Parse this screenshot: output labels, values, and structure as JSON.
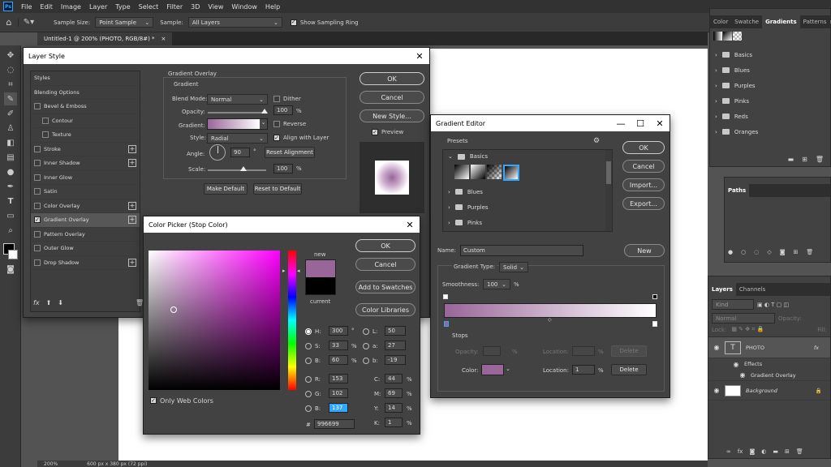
{
  "menubar": {
    "logo": "Ps",
    "items": [
      "File",
      "Edit",
      "Image",
      "Layer",
      "Type",
      "Select",
      "Filter",
      "3D",
      "View",
      "Window",
      "Help"
    ]
  },
  "options": {
    "sample_size_label": "Sample Size:",
    "sample_size_value": "Point Sample",
    "sample_label": "Sample:",
    "sample_value": "All Layers",
    "show_ring_label": "Show Sampling Ring"
  },
  "document": {
    "tab_title": "Untitled-1 @ 200% (PHOTO, RGB/8#) *",
    "close": "×"
  },
  "status": {
    "zoom": "200%",
    "size": "600 px x 380 px (72 ppi)"
  },
  "gradients_panel": {
    "tabs": [
      "Color",
      "Swatche",
      "Gradients",
      "Patterns"
    ],
    "active_tab": "Gradients",
    "folders": [
      "Basics",
      "Blues",
      "Purples",
      "Pinks",
      "Reds",
      "Oranges"
    ]
  },
  "paths_panel": {
    "title": "Paths"
  },
  "layers_panel": {
    "tabs": [
      "Layers",
      "Channels"
    ],
    "kind_placeholder": "Kind",
    "blend": "Normal",
    "opacity_label": "Opacity:",
    "lock_label": "Lock:",
    "fill_label": "Fill:",
    "layers": [
      {
        "name": "PHOTO",
        "thumb": "T",
        "fx": "fx"
      },
      {
        "name": "Effects"
      },
      {
        "name": "Gradient Overlay"
      },
      {
        "name": "Background"
      }
    ]
  },
  "layer_style": {
    "title": "Layer Style",
    "styles": [
      {
        "label": "Styles",
        "check": false,
        "hasbox": false
      },
      {
        "label": "Blending Options",
        "check": false,
        "hasbox": false
      },
      {
        "label": "Bevel & Emboss",
        "check": false,
        "hasbox": true
      },
      {
        "label": "Contour",
        "check": false,
        "hasbox": true,
        "indent": true
      },
      {
        "label": "Texture",
        "check": false,
        "hasbox": true,
        "indent": true
      },
      {
        "label": "Stroke",
        "check": false,
        "hasbox": true,
        "plus": true
      },
      {
        "label": "Inner Shadow",
        "check": false,
        "hasbox": true,
        "plus": true
      },
      {
        "label": "Inner Glow",
        "check": false,
        "hasbox": true
      },
      {
        "label": "Satin",
        "check": false,
        "hasbox": true
      },
      {
        "label": "Color Overlay",
        "check": false,
        "hasbox": true,
        "plus": true
      },
      {
        "label": "Gradient Overlay",
        "check": true,
        "hasbox": true,
        "plus": true,
        "active": true
      },
      {
        "label": "Pattern Overlay",
        "check": false,
        "hasbox": true
      },
      {
        "label": "Outer Glow",
        "check": false,
        "hasbox": true
      },
      {
        "label": "Drop Shadow",
        "check": false,
        "hasbox": true,
        "plus": true
      }
    ],
    "section_title": "Gradient Overlay",
    "group_title": "Gradient",
    "blend_label": "Blend Mode:",
    "blend_value": "Normal",
    "dither_label": "Dither",
    "opacity_label": "Opacity:",
    "opacity_value": "100",
    "pct": "%",
    "gradient_label": "Gradient:",
    "reverse_label": "Reverse",
    "style_label": "Style:",
    "style_value": "Radial",
    "align_label": "Align with Layer",
    "angle_label": "Angle:",
    "angle_value": "90",
    "deg": "°",
    "reset_alignment": "Reset Alignment",
    "scale_label": "Scale:",
    "scale_value": "100",
    "make_default": "Make Default",
    "reset_default": "Reset to Default",
    "ok": "OK",
    "cancel": "Cancel",
    "new_style": "New Style...",
    "preview_label": "Preview",
    "fx": "fx"
  },
  "gradient_editor": {
    "title": "Gradient Editor",
    "presets_label": "Presets",
    "folders": [
      "Basics",
      "Blues",
      "Purples",
      "Pinks"
    ],
    "ok": "OK",
    "cancel": "Cancel",
    "import": "Import...",
    "export": "Export...",
    "name_label": "Name:",
    "name_value": "Custom",
    "new": "New",
    "type_label": "Gradient Type:",
    "type_value": "Solid",
    "smooth_label": "Smoothness:",
    "smooth_value": "100",
    "pct": "%",
    "stops_label": "Stops",
    "opacity_label": "Opacity:",
    "location_label": "Location:",
    "delete": "Delete",
    "color_label": "Color:",
    "location_value": "1"
  },
  "color_picker": {
    "title": "Color Picker (Stop Color)",
    "ok": "OK",
    "cancel": "Cancel",
    "add_swatches": "Add to Swatches",
    "color_libraries": "Color Libraries",
    "new_label": "new",
    "current_label": "current",
    "only_web": "Only Web Colors",
    "new_color": "#996699",
    "current_color": "#000000",
    "fields": {
      "H": "300",
      "S": "33",
      "B": "60",
      "R": "153",
      "G": "102",
      "Bl": "137",
      "L": "50",
      "a": "27",
      "b": "-19",
      "C": "44",
      "M": "69",
      "Y": "14",
      "K": "1"
    },
    "units": {
      "deg": "°",
      "pct": "%"
    },
    "hex_label": "#",
    "hex": "996699"
  }
}
